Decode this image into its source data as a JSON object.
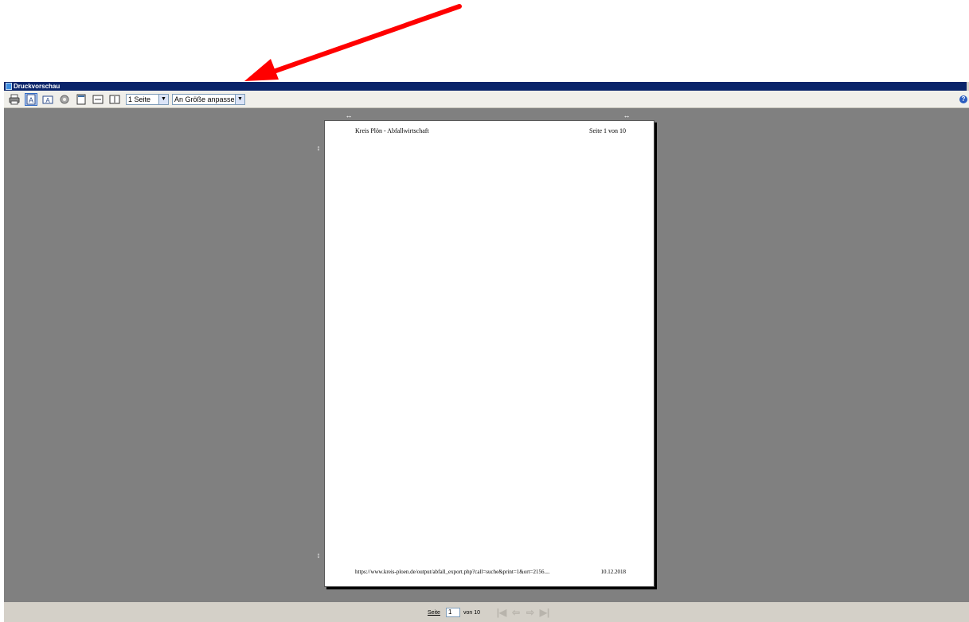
{
  "window": {
    "title": "Druckvorschau"
  },
  "toolbar": {
    "pages_select": "1 Seite",
    "zoom_select": "An Größe anpassen",
    "help_glyph": "?"
  },
  "preview": {
    "header_left": "Kreis Plön - Abfallwirtschaft",
    "header_right": "Seite 1 von 10",
    "footer_url": "https://www.kreis-ploen.de/output/abfall_export.php?call=suche&print=1&ort=2156....",
    "footer_date": "10.12.2018"
  },
  "statusbar": {
    "page_label": "Seite",
    "page_value": "1",
    "total_label": "von 10"
  },
  "colors": {
    "titlebar": "#0a246a",
    "background": "#808080",
    "arrow": "#ff0000"
  }
}
